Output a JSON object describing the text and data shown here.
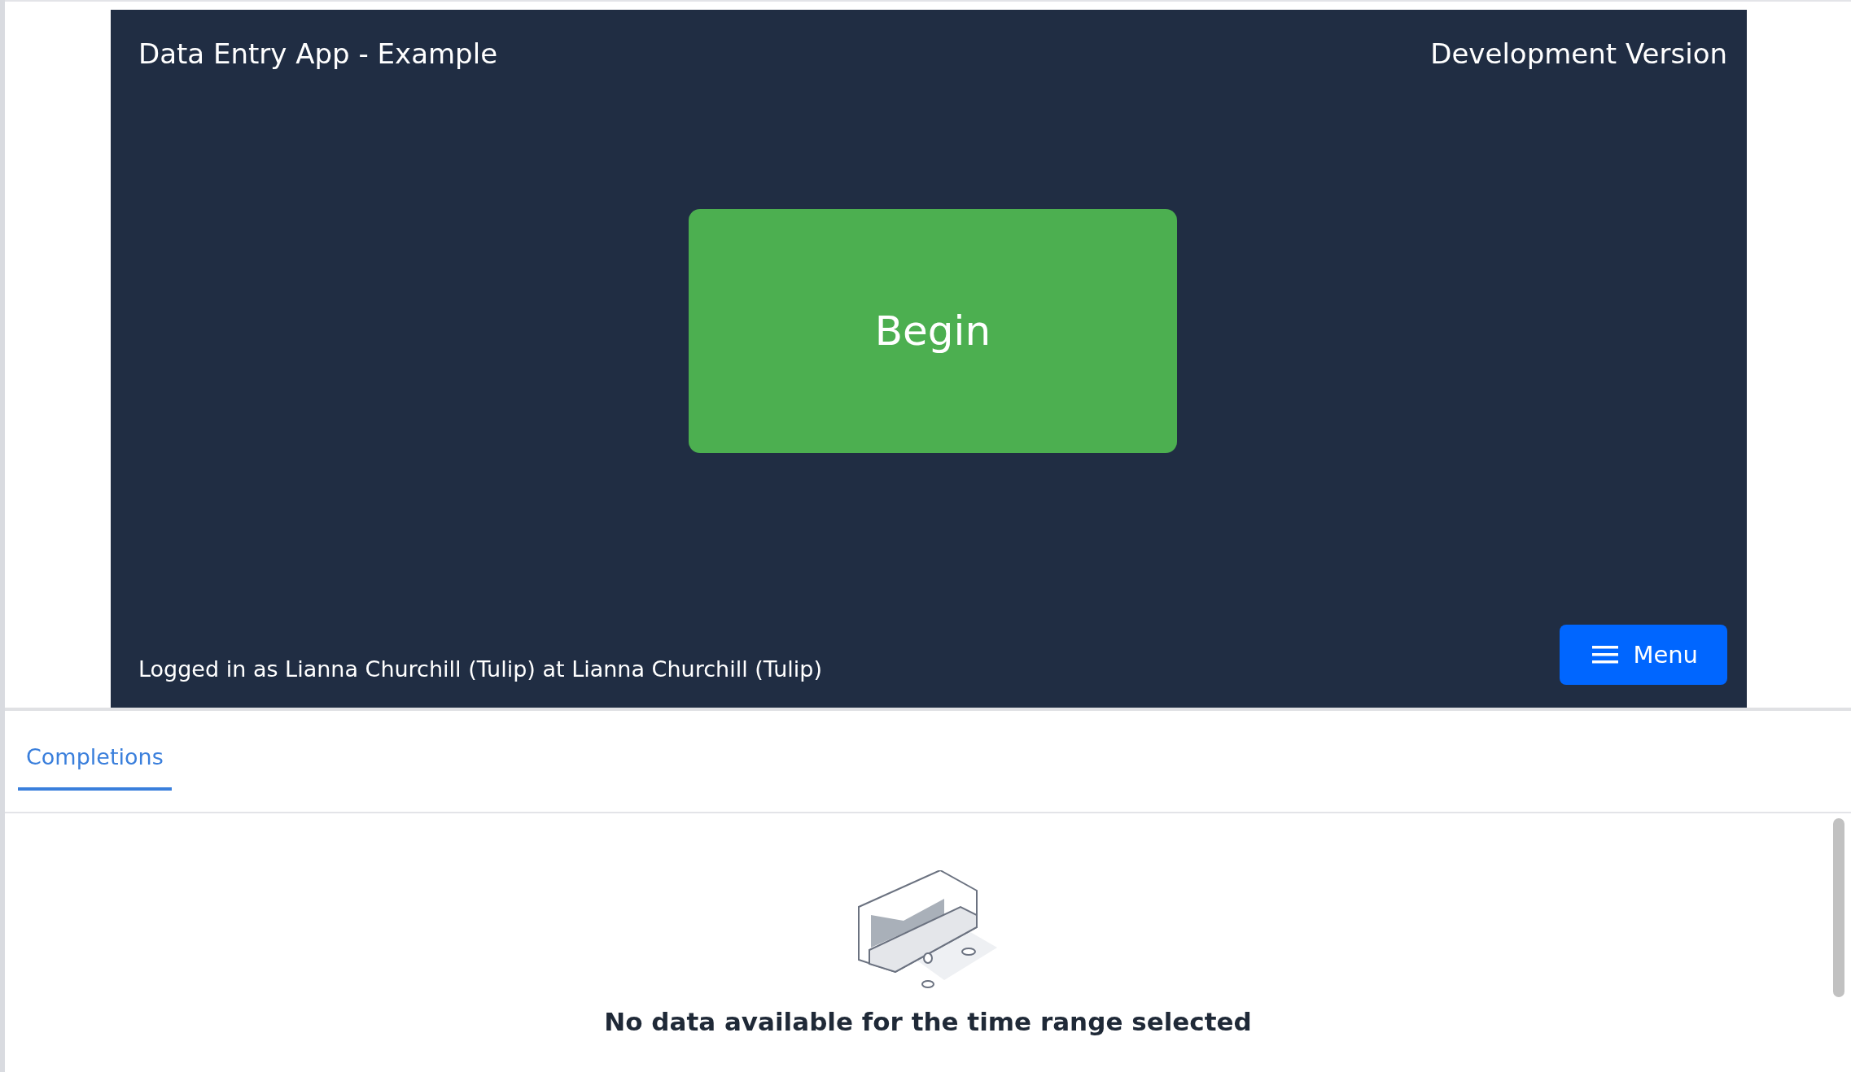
{
  "app": {
    "title": "Data Entry App - Example",
    "version": "Development Version",
    "begin_button": "Begin",
    "login_text": "Logged in as Lianna Churchill (Tulip) at Lianna Churchill (Tulip)",
    "menu_button": "Menu"
  },
  "tabs": [
    {
      "label": "Completions",
      "selected": true
    }
  ],
  "empty_state": {
    "heading": "No data available for the time range selected"
  }
}
